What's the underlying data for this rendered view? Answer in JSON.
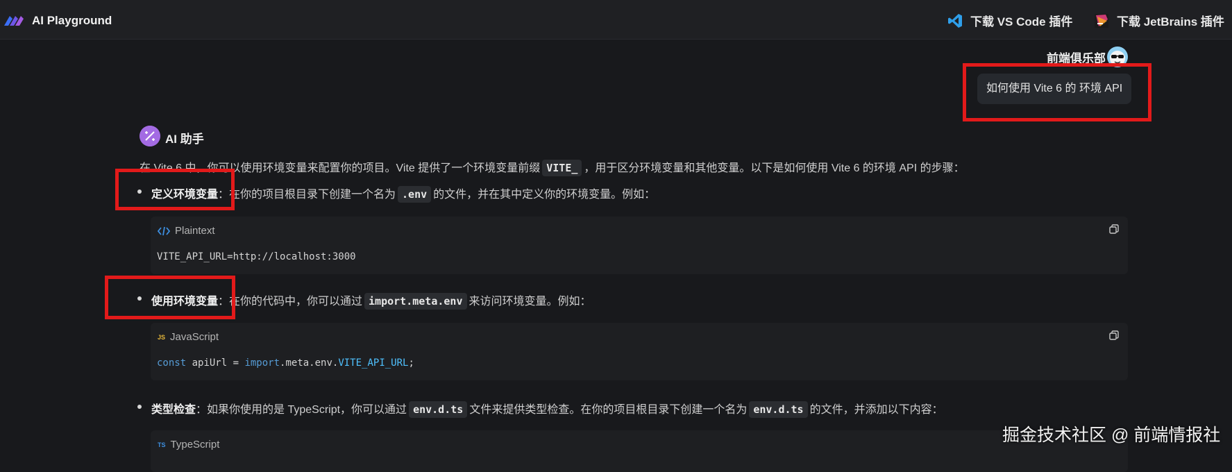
{
  "header": {
    "app_title": "AI Playground",
    "vscode_label": "下载 VS Code 插件",
    "jetbrains_label": "下载 JetBrains 插件"
  },
  "user": {
    "name": "前端俱乐部",
    "message": "如何使用 Vite 6 的 环境 API"
  },
  "assistant": {
    "name": "AI 助手",
    "intro_parts": [
      "在 Vite 6 中，你可以使用环境变量来配置你的项目。Vite 提供了一个环境变量前缀",
      "VITE_",
      "，用于区分环境变量和其他变量。以下是如何使用 Vite 6 的环境 API 的步骤："
    ],
    "bullets": [
      {
        "title": "定义环境变量",
        "text_before": "：在你的项目根目录下创建一个名为",
        "code": ".env",
        "text_after": "的文件，并在其中定义你的环境变量。例如："
      },
      {
        "title": "使用环境变量",
        "text_before": "：在你的代码中，你可以通过",
        "code": "import.meta.env",
        "text_after": "来访问环境变量。例如："
      },
      {
        "title": "类型检查",
        "text_before": "：如果你使用的是 TypeScript，你可以通过",
        "code": "env.d.ts",
        "text_middle": "文件来提供类型检查。在你的项目根目录下创建一个名为",
        "code2": "env.d.ts",
        "text_after": "的文件，并添加以下内容："
      }
    ],
    "code_blocks": [
      {
        "lang": "Plaintext",
        "lang_icon": "code-brackets-icon",
        "code": "VITE_API_URL=http://localhost:3000"
      },
      {
        "lang": "JavaScript",
        "lang_icon": "js-icon",
        "badge": "JS",
        "tokens": [
          "const",
          " apiUrl = ",
          "import",
          ".meta.env.",
          "VITE_API_URL",
          ";"
        ]
      },
      {
        "lang": "TypeScript",
        "lang_icon": "ts-icon",
        "badge": "TS"
      }
    ]
  },
  "watermark": "掘金技术社区 @ 前端情报社",
  "colors": {
    "background": "#18191c",
    "highlight_box": "#e21a1a",
    "assistant_avatar": "#a36be3",
    "keyword": "#569cd6"
  }
}
